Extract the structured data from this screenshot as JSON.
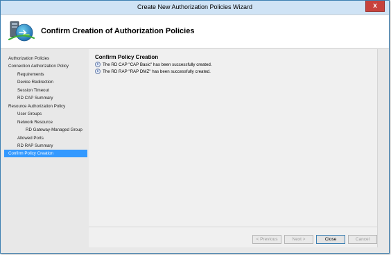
{
  "window": {
    "title": "Create New Authorization Policies Wizard",
    "close_label": "x"
  },
  "header": {
    "title": "Confirm Creation of Authorization Policies",
    "icon": "policy-wizard-icon"
  },
  "sidebar": {
    "items": [
      {
        "label": "Authorization Policies",
        "level": 0
      },
      {
        "label": "Connection Authorization Policy",
        "level": 0
      },
      {
        "label": "Requirements",
        "level": 1
      },
      {
        "label": "Device Redirection",
        "level": 1
      },
      {
        "label": "Session Timeout",
        "level": 1
      },
      {
        "label": "RD CAP Summary",
        "level": 1
      },
      {
        "label": "Resource Authorization Policy",
        "level": 0
      },
      {
        "label": "User Groups",
        "level": 1
      },
      {
        "label": "Network Resource",
        "level": 1
      },
      {
        "label": "RD Gateway-Managed Group",
        "level": 2
      },
      {
        "label": "Allowed Ports",
        "level": 1
      },
      {
        "label": "RD RAP Summary",
        "level": 1
      },
      {
        "label": "Confirm Policy Creation",
        "level": 0,
        "active": true
      }
    ]
  },
  "content": {
    "section_title": "Confirm Policy Creation",
    "messages": [
      "The RD CAP \"CAP Basic\" has been successfully created.",
      "The RD RAP \"RAP DMZ\" has been successfully created."
    ]
  },
  "footer": {
    "previous_label": "< Previous",
    "next_label": "Next >",
    "close_label": "Close",
    "cancel_label": "Cancel"
  },
  "colors": {
    "accent": "#3399ff",
    "title_bar": "#cfe3f5",
    "close_button": "#c7423c"
  }
}
